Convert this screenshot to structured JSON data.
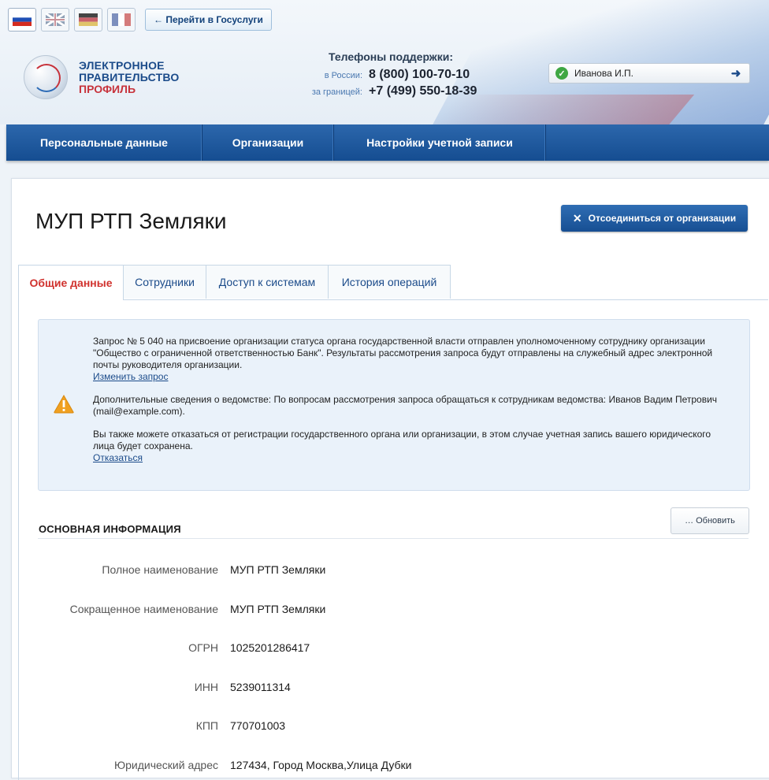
{
  "header": {
    "languages": [
      "ru",
      "en",
      "de",
      "fr"
    ],
    "goto_button": "← Перейти в Госуслуги",
    "logo": {
      "line1": "ЭЛЕКТРОННОЕ",
      "line2": "ПРАВИТЕЛЬСТВО",
      "line3": "ПРОФИЛЬ"
    },
    "support": {
      "title": "Телефоны поддержки:",
      "russia_label": "в России:",
      "russia_phone": "8 (800) 100-70-10",
      "abroad_label": "за границей:",
      "abroad_phone": "+7 (499) 550-18-39"
    },
    "user": {
      "name": "Иванова И.П."
    }
  },
  "nav": [
    "Персональные данные",
    "Организации",
    "Настройки учетной записи"
  ],
  "page": {
    "title": "МУП РТП Земляки",
    "disconnect_button": "Отсоединиться от организации",
    "tabs": [
      "Общие данные",
      "Сотрудники",
      "Доступ к системам",
      "История операций"
    ]
  },
  "notice": {
    "p1": "Запрос № 5 040 на присвоение организации статуса органа государственной власти отправлен уполномоченному сотруднику организации \"Общество с ограниченной ответственностью Банк\". Результаты рассмотрения запроса будут отправлены на служебный адрес электронной почты руководителя организации.",
    "p1_link": "Изменить запрос",
    "p2": "Дополнительные сведения о ведомстве: По вопросам рассмотрения запроса обращаться к сотрудникам ведомства: Иванов Вадим Петрович (mail@example.com).",
    "p3": "Вы также можете отказаться от регистрации государственного органа или организации, в этом случае учетная запись вашего юридического лица будет сохранена.",
    "p3_link": "Отказаться"
  },
  "section": {
    "title": "ОСНОВНАЯ ИНФОРМАЦИЯ",
    "update_button": "Обновить",
    "fields": [
      {
        "label": "Полное наименование",
        "value": "МУП РТП Земляки"
      },
      {
        "label": "Сокращенное наименование",
        "value": "МУП РТП Земляки"
      },
      {
        "label": "ОГРН",
        "value": "1025201286417"
      },
      {
        "label": "ИНН",
        "value": "5239011314"
      },
      {
        "label": "КПП",
        "value": "770701003"
      },
      {
        "label": "Юридический адрес",
        "value": "127434, Город Москва,Улица Дубки"
      }
    ]
  },
  "colors": {
    "nav": "#1b57a0",
    "accent_red": "#d0312d",
    "link": "#1b4b8a",
    "notice_bg": "#eaf2fa"
  }
}
